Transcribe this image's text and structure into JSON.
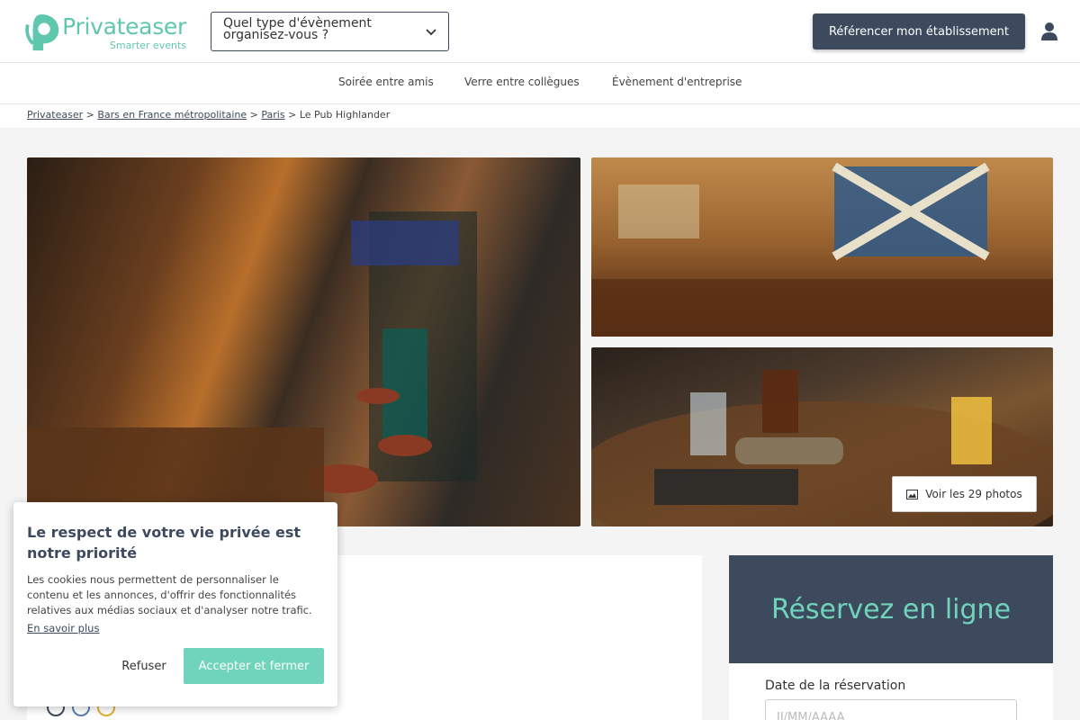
{
  "brand": {
    "name": "Privateaser",
    "tagline": "Smarter events",
    "accent": "#5fc7ae",
    "dark": "#3d4a5e"
  },
  "header": {
    "event_select_label": "Quel type d'évènement organisez-vous ?",
    "referencer_label": "Référencer mon établissement",
    "user_icon": "user-icon"
  },
  "nav": {
    "items": [
      "Soirée entre amis",
      "Verre entre collègues",
      "Évènement d'entreprise"
    ]
  },
  "breadcrumb": {
    "items": [
      "Privateaser",
      "Bars en France métropolitaine",
      "Paris"
    ],
    "current": "Le Pub Highlander",
    "separator": ">"
  },
  "gallery": {
    "see_photos_label": "Voir les 29 photos",
    "photo_icon": "image-icon"
  },
  "booking": {
    "title": "Réservez en ligne",
    "date_label": "Date de la réservation",
    "date_placeholder": "JJ/MM/AAAA"
  },
  "cookie": {
    "title": "Le respect de votre vie privée est notre priorité",
    "text": "Les cookies nous permettent de personnaliser le contenu et les annonces, d'offrir des fonctionnalités relatives aux médias sociaux et d'analyser notre trafic.",
    "link": "En savoir plus",
    "refuse": "Refuser",
    "accept": "Accepter et fermer"
  }
}
